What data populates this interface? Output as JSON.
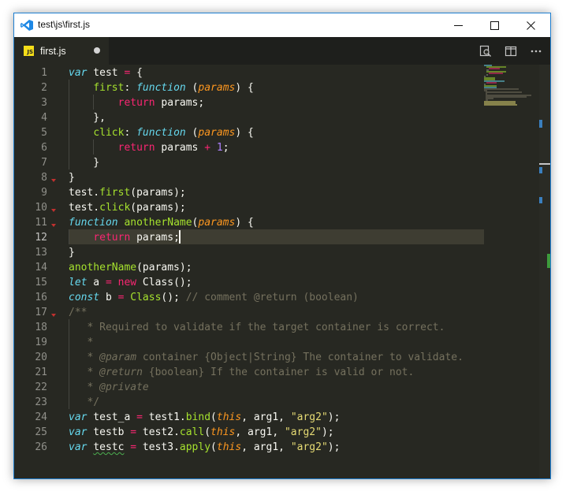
{
  "window": {
    "title": "test\\js\\first.js"
  },
  "tab": {
    "name": "first.js",
    "badge": "JS"
  },
  "icons": {
    "app": "vscode-logo-icon",
    "minimize": "minimize-icon",
    "maximize": "maximize-icon",
    "close": "close-icon",
    "compare": "open-changes-icon",
    "split": "split-editor-icon",
    "more": "more-actions-icon",
    "dirty": "unsaved-dot-icon"
  },
  "colors": {
    "accent": "#1e7fd1",
    "editor_bg": "#272822",
    "keyword": "#66d9ef",
    "function": "#a6e22e",
    "control": "#f92672",
    "param": "#fd971f",
    "string": "#e6db74",
    "number": "#ae81ff",
    "comment": "#75715e"
  },
  "editor": {
    "active_line": 12,
    "line_numbers": [
      "1",
      "2",
      "3",
      "4",
      "5",
      "6",
      "7",
      "8",
      "9",
      "10",
      "11",
      "12",
      "13",
      "14",
      "15",
      "16",
      "17",
      "18",
      "19",
      "20",
      "21",
      "22",
      "23",
      "24",
      "25",
      "26"
    ],
    "lines": [
      [
        {
          "t": "var",
          "c": "kw"
        },
        {
          "t": " test "
        },
        {
          "t": "=",
          "c": "op"
        },
        {
          "t": " {"
        }
      ],
      [
        {
          "t": "    "
        },
        {
          "t": "first",
          "c": "fn"
        },
        {
          "t": ": "
        },
        {
          "t": "function",
          "c": "kw"
        },
        {
          "t": " ("
        },
        {
          "t": "params",
          "c": "par"
        },
        {
          "t": ") {"
        }
      ],
      [
        {
          "t": "        "
        },
        {
          "t": "return",
          "c": "ctl"
        },
        {
          "t": " params;"
        }
      ],
      [
        {
          "t": "    },"
        }
      ],
      [
        {
          "t": "    "
        },
        {
          "t": "click",
          "c": "fn"
        },
        {
          "t": ": "
        },
        {
          "t": "function",
          "c": "kw"
        },
        {
          "t": " ("
        },
        {
          "t": "params",
          "c": "par"
        },
        {
          "t": ") {"
        }
      ],
      [
        {
          "t": "        "
        },
        {
          "t": "return",
          "c": "ctl"
        },
        {
          "t": " params "
        },
        {
          "t": "+",
          "c": "op"
        },
        {
          "t": " "
        },
        {
          "t": "1",
          "c": "num"
        },
        {
          "t": ";"
        }
      ],
      [
        {
          "t": "    }"
        }
      ],
      [
        {
          "t": "}"
        }
      ],
      [
        {
          "t": "test."
        },
        {
          "t": "first",
          "c": "fn"
        },
        {
          "t": "(params);"
        }
      ],
      [
        {
          "t": "test."
        },
        {
          "t": "click",
          "c": "fn"
        },
        {
          "t": "(params);"
        }
      ],
      [
        {
          "t": "function",
          "c": "kw"
        },
        {
          "t": " "
        },
        {
          "t": "anotherName",
          "c": "fn"
        },
        {
          "t": "("
        },
        {
          "t": "params",
          "c": "par"
        },
        {
          "t": ") {"
        }
      ],
      [
        {
          "t": "    "
        },
        {
          "t": "return",
          "c": "ctl"
        },
        {
          "t": " params;"
        }
      ],
      [
        {
          "t": "}"
        }
      ],
      [
        {
          "t": "anotherName",
          "c": "fn"
        },
        {
          "t": "(params);"
        }
      ],
      [
        {
          "t": "let",
          "c": "kw"
        },
        {
          "t": " a "
        },
        {
          "t": "=",
          "c": "op"
        },
        {
          "t": " "
        },
        {
          "t": "new",
          "c": "ctl"
        },
        {
          "t": " Class();"
        }
      ],
      [
        {
          "t": "const",
          "c": "kw"
        },
        {
          "t": " b "
        },
        {
          "t": "=",
          "c": "op"
        },
        {
          "t": " "
        },
        {
          "t": "Class",
          "c": "fn"
        },
        {
          "t": "(); "
        },
        {
          "t": "// comment @return (boolean)",
          "c": "cm"
        }
      ],
      [
        {
          "t": "/**",
          "c": "cm"
        }
      ],
      [
        {
          "t": "   * Required to validate if the target container is correct.",
          "c": "cm"
        }
      ],
      [
        {
          "t": "   *",
          "c": "cm"
        }
      ],
      [
        {
          "t": "   * ",
          "c": "cm"
        },
        {
          "t": "@param",
          "c": "cmi"
        },
        {
          "t": " container {Object|String} The container to validate.",
          "c": "cm"
        }
      ],
      [
        {
          "t": "   * ",
          "c": "cm"
        },
        {
          "t": "@return",
          "c": "cmi"
        },
        {
          "t": " {boolean} If the container is valid or not.",
          "c": "cm"
        }
      ],
      [
        {
          "t": "   * ",
          "c": "cm"
        },
        {
          "t": "@private",
          "c": "cmi"
        }
      ],
      [
        {
          "t": "   */",
          "c": "cm"
        }
      ],
      [
        {
          "t": "var",
          "c": "kw"
        },
        {
          "t": " test_a "
        },
        {
          "t": "=",
          "c": "op"
        },
        {
          "t": " test1."
        },
        {
          "t": "bind",
          "c": "fn"
        },
        {
          "t": "("
        },
        {
          "t": "this",
          "c": "this"
        },
        {
          "t": ", arg1, "
        },
        {
          "t": "\"arg2\"",
          "c": "str"
        },
        {
          "t": ");"
        }
      ],
      [
        {
          "t": "var",
          "c": "kw"
        },
        {
          "t": " testb "
        },
        {
          "t": "=",
          "c": "op"
        },
        {
          "t": " test2."
        },
        {
          "t": "call",
          "c": "fn"
        },
        {
          "t": "("
        },
        {
          "t": "this",
          "c": "this"
        },
        {
          "t": ", arg1, "
        },
        {
          "t": "\"arg2\"",
          "c": "str"
        },
        {
          "t": ");"
        }
      ],
      [
        {
          "t": "var",
          "c": "kw"
        },
        {
          "t": " "
        },
        {
          "t": "testc",
          "c": "squig"
        },
        {
          "t": " "
        },
        {
          "t": "=",
          "c": "op"
        },
        {
          "t": " test3."
        },
        {
          "t": "apply",
          "c": "fn"
        },
        {
          "t": "("
        },
        {
          "t": "this",
          "c": "this"
        },
        {
          "t": ", arg1, "
        },
        {
          "t": "\"arg2\"",
          "c": "str"
        },
        {
          "t": ");"
        }
      ]
    ]
  }
}
